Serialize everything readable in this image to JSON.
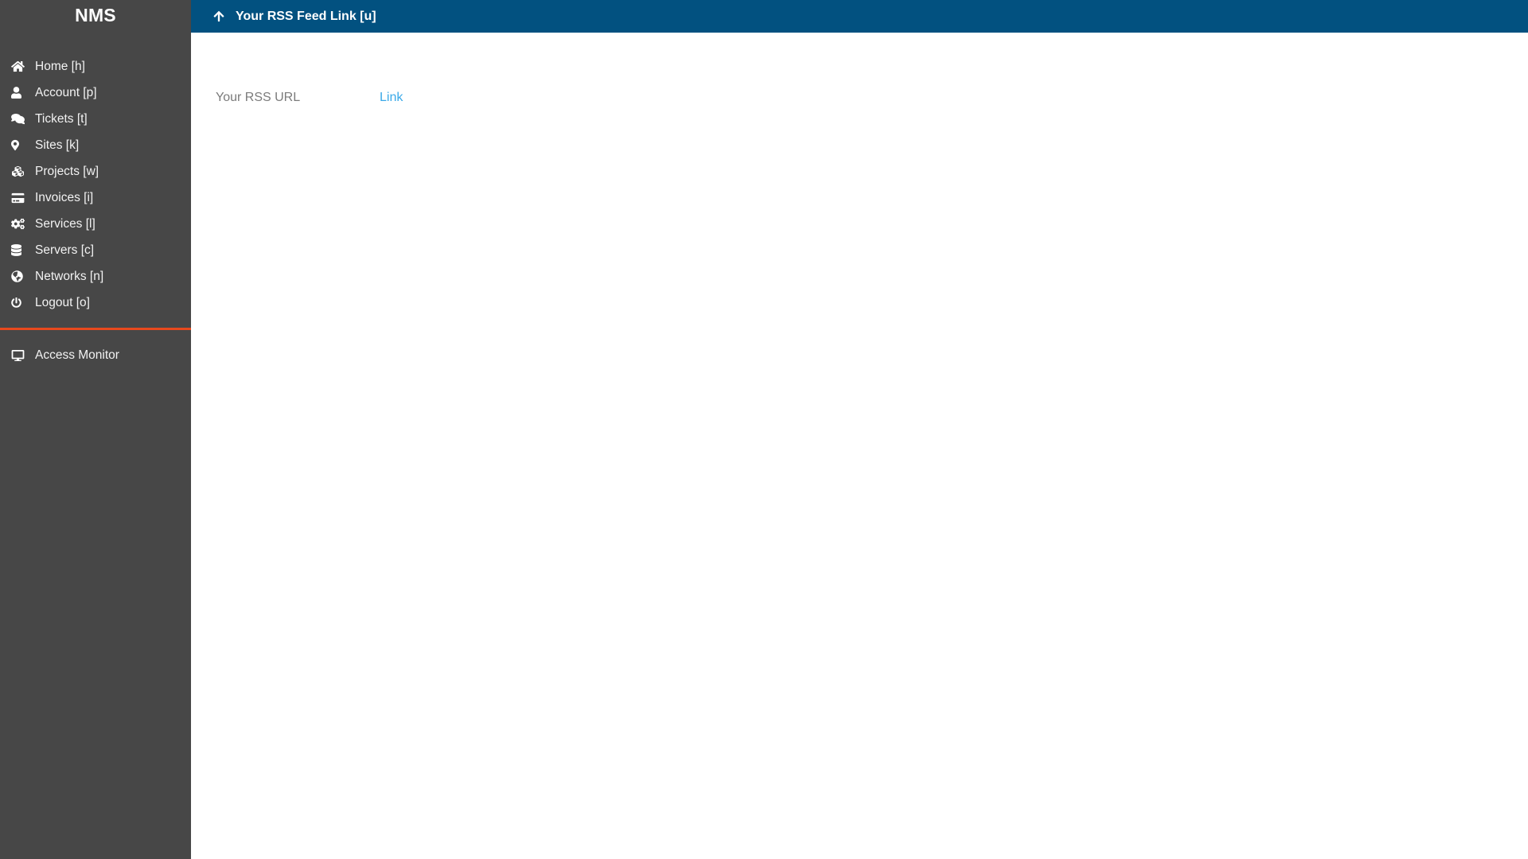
{
  "sidebar": {
    "brand": "NMS",
    "items": [
      {
        "label": "Home [h]",
        "icon": "home-icon"
      },
      {
        "label": "Account [p]",
        "icon": "user-icon"
      },
      {
        "label": "Tickets [t]",
        "icon": "comments-icon"
      },
      {
        "label": "Sites [k]",
        "icon": "map-marker-icon"
      },
      {
        "label": "Projects [w]",
        "icon": "cubes-icon"
      },
      {
        "label": "Invoices [i]",
        "icon": "credit-card-icon"
      },
      {
        "label": "Services [l]",
        "icon": "cogs-icon"
      },
      {
        "label": "Servers [c]",
        "icon": "database-icon"
      },
      {
        "label": "Networks [n]",
        "icon": "globe-icon"
      },
      {
        "label": "Logout [o]",
        "icon": "power-icon"
      }
    ],
    "secondary_items": [
      {
        "label": "Access Monitor",
        "icon": "desktop-icon"
      }
    ],
    "separator_color": "#e8491d",
    "background_color": "#474747"
  },
  "topbar": {
    "title": "Your RSS Feed Link [u]",
    "icon": "arrow-up-icon",
    "background_color": "#025180"
  },
  "content": {
    "rss_url_label": "Your RSS URL",
    "rss_link_text": "Link",
    "link_color": "#3aa9e8"
  }
}
